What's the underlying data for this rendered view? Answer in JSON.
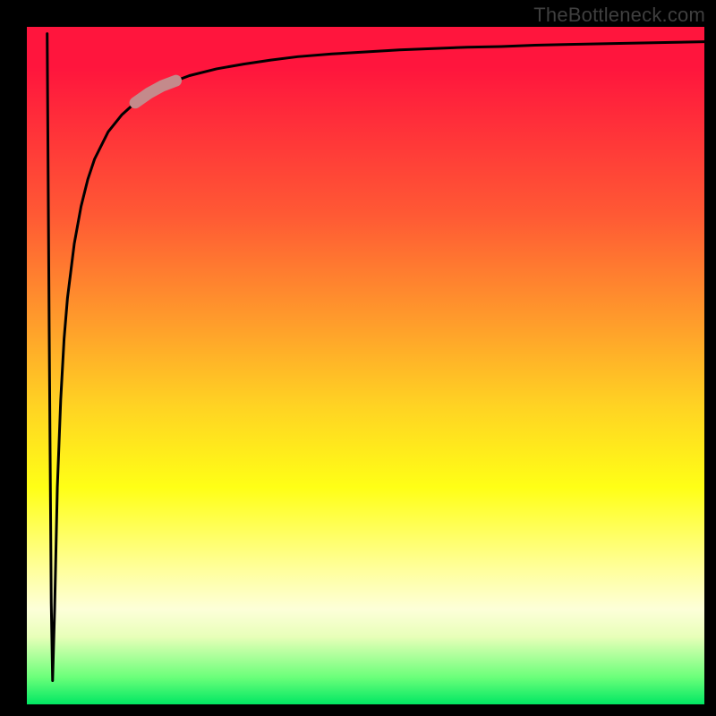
{
  "watermark": "TheBottleneck.com",
  "colors": {
    "page_bg": "#000000",
    "curve": "#000000",
    "highlight": "#c48a8b",
    "watermark": "#3f3f3f"
  },
  "chart_data": {
    "type": "line",
    "title": "",
    "xlabel": "",
    "ylabel": "",
    "xlim": [
      0,
      100
    ],
    "ylim": [
      0,
      100
    ],
    "grid": false,
    "series": [
      {
        "name": "bottleneck-curve",
        "x": [
          3.0,
          3.3,
          3.6,
          3.8,
          4.1,
          4.5,
          5.0,
          5.5,
          6.0,
          7.0,
          8.0,
          9.0,
          10.0,
          12.0,
          14.0,
          16.0,
          18.0,
          20.0,
          24.0,
          28.0,
          32.0,
          36.0,
          40.0,
          45.0,
          50.0,
          55.0,
          60.0,
          65.0,
          70.0,
          75.0,
          80.0,
          85.0,
          90.0,
          95.0,
          100.0
        ],
        "values": [
          99.0,
          55.0,
          15.0,
          3.5,
          14.0,
          32.0,
          45.0,
          54.0,
          60.0,
          68.0,
          73.5,
          77.5,
          80.5,
          84.5,
          87.0,
          88.8,
          90.2,
          91.3,
          92.8,
          93.8,
          94.5,
          95.1,
          95.6,
          96.0,
          96.3,
          96.6,
          96.8,
          97.0,
          97.1,
          97.3,
          97.4,
          97.5,
          97.6,
          97.7,
          97.8
        ]
      }
    ],
    "annotations": [
      {
        "type": "highlight-segment",
        "on_series": "bottleneck-curve",
        "x_range": [
          16.0,
          22.0
        ]
      }
    ],
    "background_gradient": {
      "direction": "top-to-bottom",
      "stops": [
        {
          "pos": 0.0,
          "color": "#ff153d"
        },
        {
          "pos": 0.28,
          "color": "#ff5a34"
        },
        {
          "pos": 0.44,
          "color": "#ff9e2b"
        },
        {
          "pos": 0.56,
          "color": "#ffd323"
        },
        {
          "pos": 0.68,
          "color": "#ffff16"
        },
        {
          "pos": 0.8,
          "color": "#ffff9b"
        },
        {
          "pos": 0.86,
          "color": "#fdffd9"
        },
        {
          "pos": 0.9,
          "color": "#e8ffb9"
        },
        {
          "pos": 0.96,
          "color": "#6bff7a"
        },
        {
          "pos": 1.0,
          "color": "#01e763"
        }
      ]
    }
  }
}
